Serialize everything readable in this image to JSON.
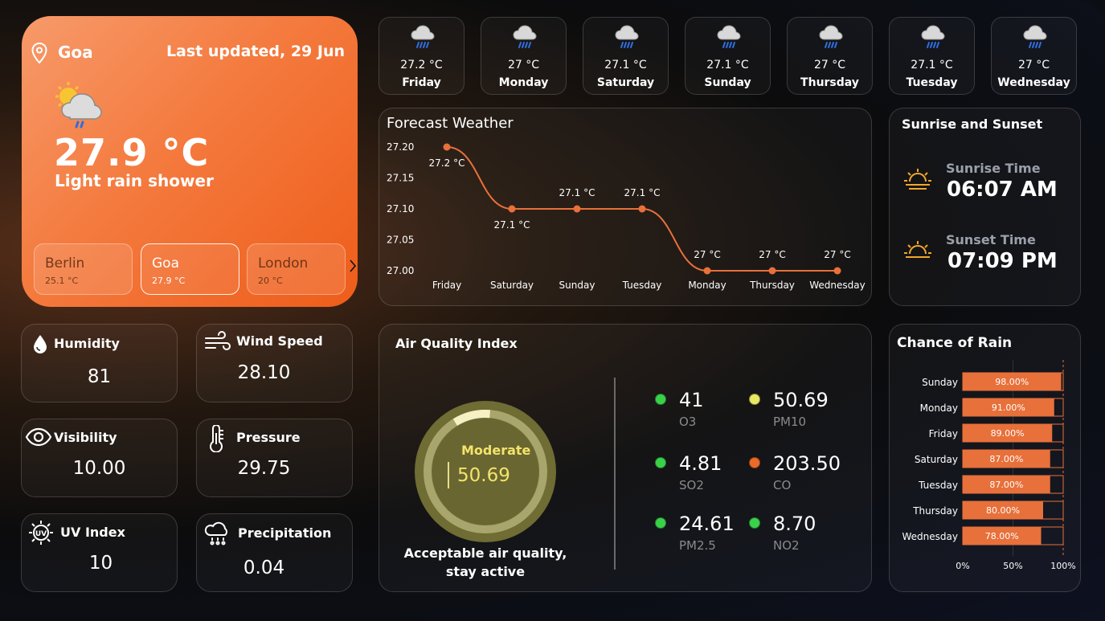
{
  "current": {
    "location": "Goa",
    "last_updated": "Last updated, 29 Jun",
    "temperature": "27.9 °C",
    "condition": "Light rain shower",
    "icon": "partly-cloudy-rain-icon"
  },
  "cities": [
    {
      "name": "Berlin",
      "temp": "25.1 °C"
    },
    {
      "name": "Goa",
      "temp": "27.9 °C"
    },
    {
      "name": "London",
      "temp": "20 °C"
    }
  ],
  "days": [
    {
      "temp": "27.2 °C",
      "name": "Friday"
    },
    {
      "temp": "27 °C",
      "name": "Monday"
    },
    {
      "temp": "27.1 °C",
      "name": "Saturday"
    },
    {
      "temp": "27.1 °C",
      "name": "Sunday"
    },
    {
      "temp": "27 °C",
      "name": "Thursday"
    },
    {
      "temp": "27.1 °C",
      "name": "Tuesday"
    },
    {
      "temp": "27 °C",
      "name": "Wednesday"
    }
  ],
  "stats": {
    "humidity": {
      "label": "Humidity",
      "value": "81"
    },
    "wind": {
      "label": "Wind Speed",
      "value": "28.10"
    },
    "visibility": {
      "label": "Visibility",
      "value": "10.00"
    },
    "pressure": {
      "label": "Pressure",
      "value": "29.75"
    },
    "uv": {
      "label": "UV Index",
      "value": "10"
    },
    "precip": {
      "label": "Precipitation",
      "value": "0.04"
    }
  },
  "sun": {
    "title": "Sunrise and Sunset",
    "sunrise_label": "Sunrise Time",
    "sunrise": "06:07 AM",
    "sunset_label": "Sunset Time",
    "sunset": "07:09 PM"
  },
  "aqi": {
    "title": "Air Quality Index",
    "status": "Moderate",
    "value": "50.69",
    "gauge_fraction": 0.1,
    "message_line1": "Acceptable air quality,",
    "message_line2": "stay active",
    "pollutants": [
      {
        "value": "41",
        "label": "O3",
        "color": "#3ad14a"
      },
      {
        "value": "50.69",
        "label": "PM10",
        "color": "#e8e865"
      },
      {
        "value": "4.81",
        "label": "SO2",
        "color": "#3ad14a"
      },
      {
        "value": "203.50",
        "label": "CO",
        "color": "#ea6a2a"
      },
      {
        "value": "24.61",
        "label": "PM2.5",
        "color": "#3ad14a"
      },
      {
        "value": "8.70",
        "label": "NO2",
        "color": "#3ad14a"
      }
    ]
  },
  "chart_data": [
    {
      "type": "line",
      "title": "Forecast Weather",
      "categories": [
        "Friday",
        "Saturday",
        "Sunday",
        "Tuesday",
        "Monday",
        "Thursday",
        "Wednesday"
      ],
      "values": [
        27.2,
        27.1,
        27.1,
        27.1,
        27.0,
        27.0,
        27.0
      ],
      "data_labels": [
        "27.2 °C",
        "27.1 °C",
        "27.1 °C",
        "27.1 °C",
        "27 °C",
        "27 °C",
        "27 °C"
      ],
      "yticks": [
        "27.20",
        "27.15",
        "27.10",
        "27.05",
        "27.00"
      ],
      "ylim": [
        27.0,
        27.2
      ],
      "color": "#e8703a",
      "grid": false
    },
    {
      "type": "bar",
      "orientation": "horizontal",
      "title": "Chance of Rain",
      "categories": [
        "Sunday",
        "Monday",
        "Friday",
        "Saturday",
        "Tuesday",
        "Thursday",
        "Wednesday"
      ],
      "values": [
        98,
        91,
        89,
        87,
        87,
        80,
        78
      ],
      "data_labels": [
        "98.00%",
        "91.00%",
        "89.00%",
        "87.00%",
        "87.00%",
        "80.00%",
        "78.00%"
      ],
      "xticks": [
        "0%",
        "50%",
        "100%"
      ],
      "xlim": [
        0,
        100
      ],
      "color": "#e8703a"
    }
  ]
}
